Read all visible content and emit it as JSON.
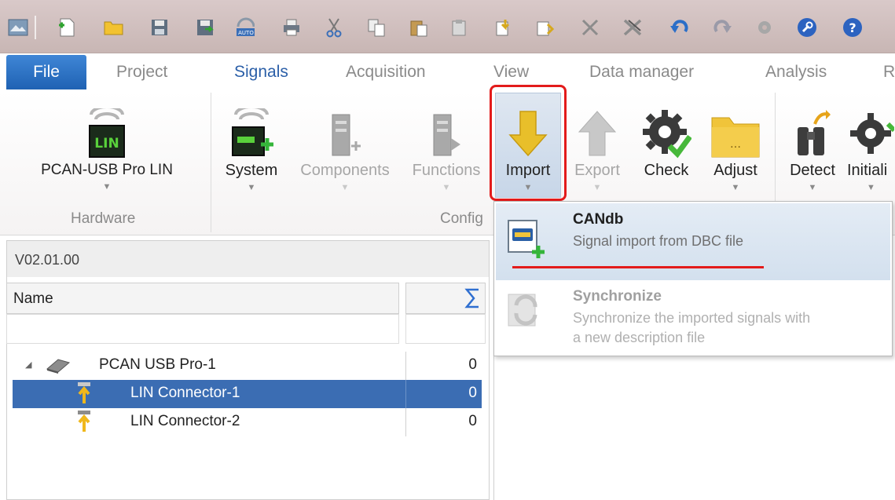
{
  "colors": {
    "accent": "#1f62b3",
    "highlight": "#e31b1b",
    "selection": "#3b6db3"
  },
  "tabs": {
    "file": "File",
    "items": [
      "Project",
      "Signals",
      "Acquisition",
      "View",
      "Data manager",
      "Analysis",
      "R"
    ]
  },
  "ribbon": {
    "hardware_button": "PCAN-USB Pro LIN",
    "hardware_group": "Hardware",
    "system": "System",
    "components": "Components",
    "functions": "Functions",
    "import": "Import",
    "export": "Export",
    "check": "Check",
    "adjust": "Adjust",
    "detect": "Detect",
    "initiali": "Initiali",
    "config_group": "Config",
    "lin_logo": "LIN"
  },
  "dropdown": {
    "candb_title": "CANdb",
    "candb_desc": "Signal import from DBC file",
    "sync_title": "Synchronize",
    "sync_desc1": "Synchronize the imported signals with",
    "sync_desc2": "a new description file"
  },
  "panel": {
    "version": "V02.01.00",
    "col_name": "Name",
    "rows": [
      {
        "name": "PCAN USB Pro-1",
        "value": "0"
      },
      {
        "name": "LIN Connector-1",
        "value": "0"
      },
      {
        "name": "LIN Connector-2",
        "value": "0"
      }
    ]
  }
}
